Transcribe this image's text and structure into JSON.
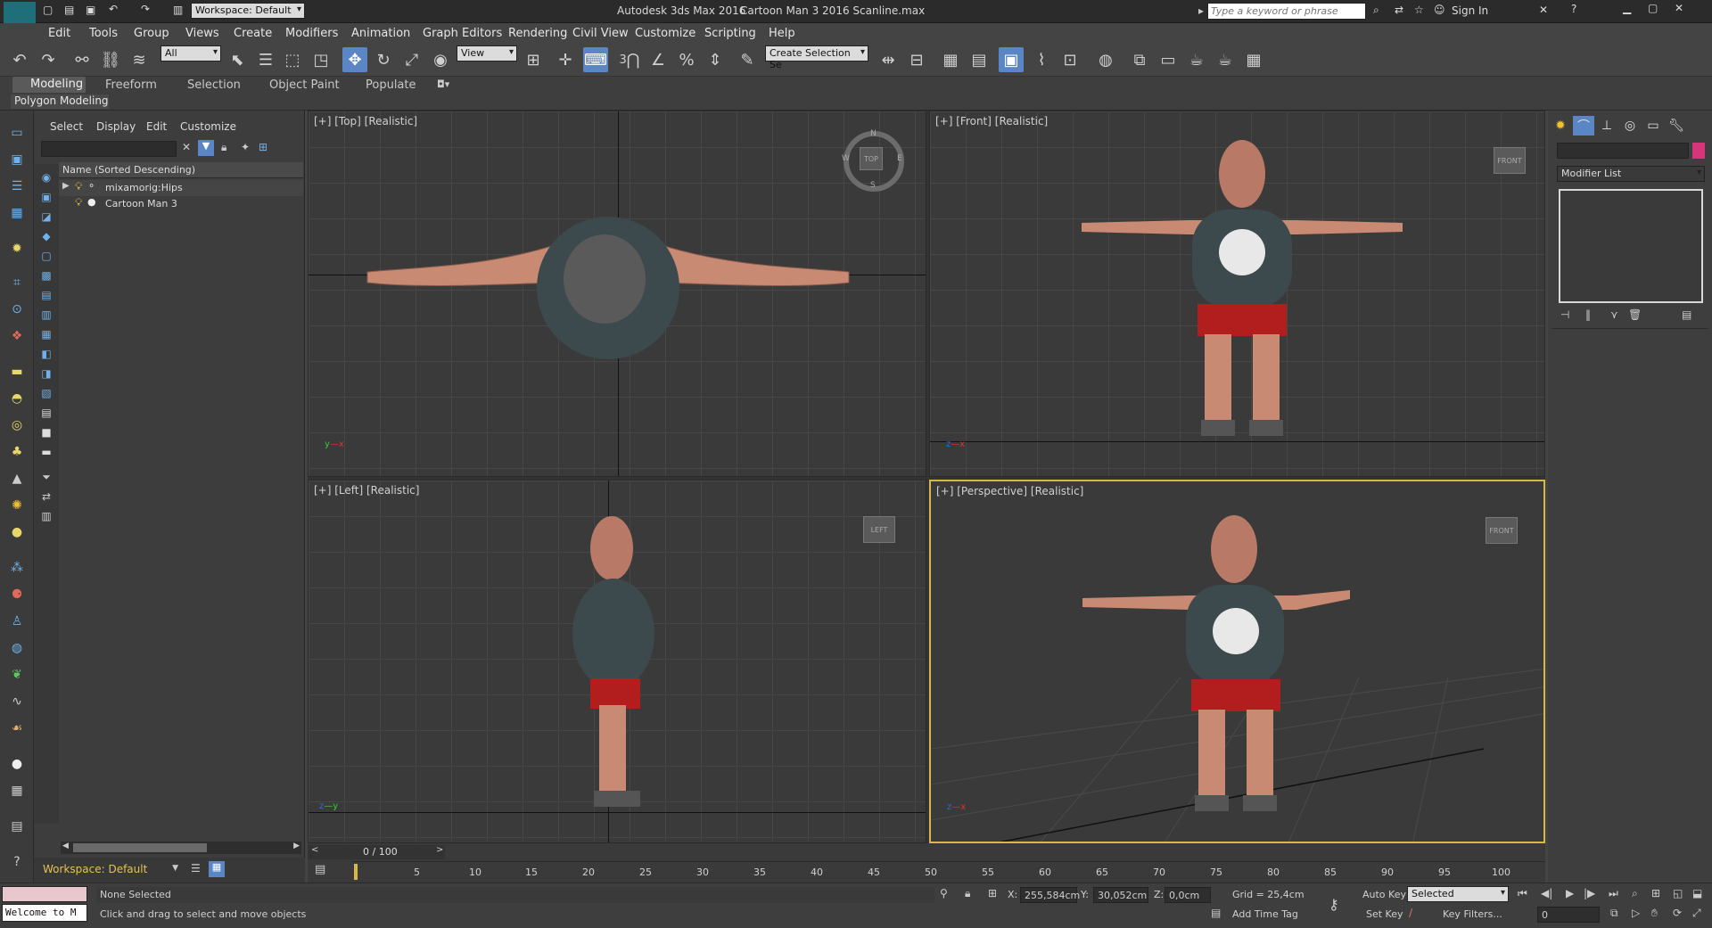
{
  "title_bar": {
    "workspace": "Workspace: Default",
    "app_title": "Autodesk 3ds Max 2016",
    "file_title": "Cartoon Man 3 2016 Scanline.max",
    "search_placeholder": "Type a keyword or phrase",
    "sign_in": "Sign In"
  },
  "menu": [
    "Edit",
    "Tools",
    "Group",
    "Views",
    "Create",
    "Modifiers",
    "Animation",
    "Graph Editors",
    "Rendering",
    "Civil View",
    "Customize",
    "Scripting",
    "Help"
  ],
  "toolbar": {
    "selection_filter": "All",
    "reference_coord": "View",
    "named_selection": "Create Selection Se",
    "snap_label": "3"
  },
  "ribbon": {
    "tabs": [
      "Modeling",
      "Freeform",
      "Selection",
      "Object Paint",
      "Populate"
    ],
    "subtitle": "Polygon Modeling"
  },
  "scene_explorer": {
    "tabs": [
      "Select",
      "Display",
      "Edit",
      "Customize"
    ],
    "column_header": "Name (Sorted Descending)",
    "items": [
      "mixamorig:Hips",
      "Cartoon Man 3"
    ],
    "workspace": "Workspace: Default"
  },
  "viewports": {
    "top": "[+] [Top] [Realistic]",
    "front": "[+] [Front] [Realistic]",
    "left": "[+] [Left] [Realistic]",
    "perspective": "[+] [Perspective] [Realistic]",
    "compass": {
      "n": "N",
      "s": "S",
      "e": "E",
      "w": "W"
    },
    "cube_top": "TOP",
    "cube_front": "FRONT",
    "cube_left": "LEFT",
    "cube_persp": "FRONT"
  },
  "command_panel": {
    "modifier_list": "Modifier List",
    "object_color": "#d6357a"
  },
  "timeline": {
    "frame_counter": "0 / 100",
    "ticks": [
      "0",
      "5",
      "10",
      "15",
      "20",
      "25",
      "30",
      "35",
      "40",
      "45",
      "50",
      "55",
      "60",
      "65",
      "70",
      "75",
      "80",
      "85",
      "90",
      "95",
      "100"
    ]
  },
  "status_bar": {
    "listener": "Welcome to M",
    "selection": "None Selected",
    "prompt": "Click and drag to select and move objects",
    "x_label": "X:",
    "x_value": "255,584cm",
    "y_label": "Y:",
    "y_value": "30,052cm",
    "z_label": "Z:",
    "z_value": "0,0cm",
    "grid": "Grid = 25,4cm",
    "add_time_tag": "Add Time Tag",
    "auto_key": "Auto Key",
    "set_key": "Set Key",
    "key_mode": "Selected",
    "key_filters": "Key Filters...",
    "current_frame": "0"
  },
  "colors": {
    "accent_blue": "#5a86c6",
    "active_viewport": "#d6b847",
    "viewport_bg": "#3a3a3a"
  }
}
